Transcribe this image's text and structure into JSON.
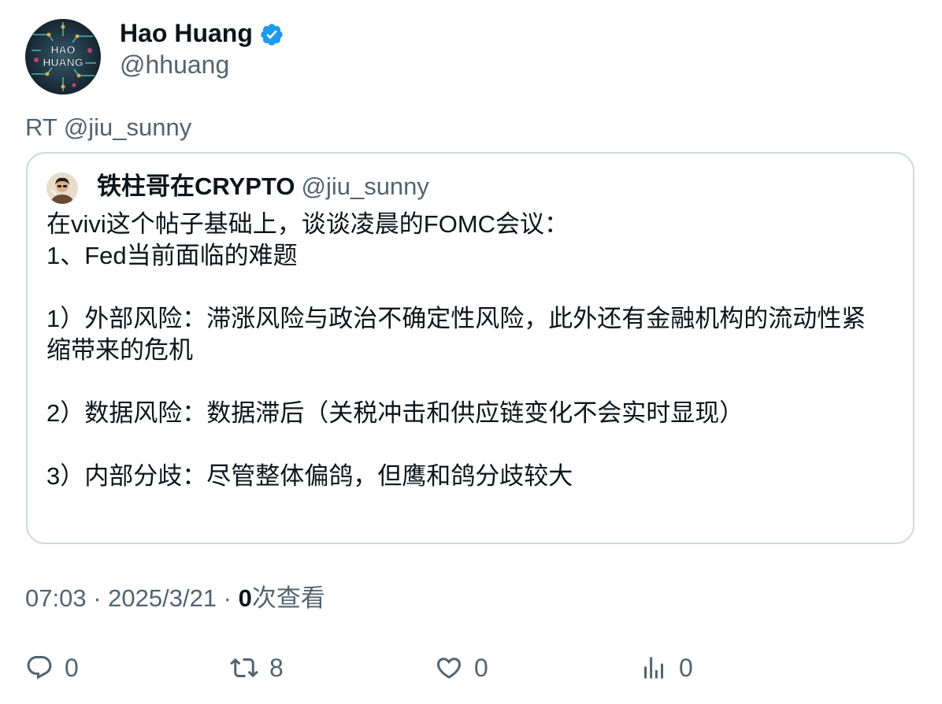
{
  "author": {
    "name": "Hao Huang",
    "handle": "@hhuang",
    "avatar_text_line1": "HAO",
    "avatar_text_line2": "HUANG",
    "verified_color": "#1d9bf0"
  },
  "retweet_line": "RT @jiu_sunny",
  "quote": {
    "author_name": "铁柱哥在CRYPTO",
    "author_handle": "@jiu_sunny",
    "lines": [
      "在vivi这个帖子基础上，谈谈凌晨的FOMC会议：",
      "1、Fed当前面临的难题",
      "",
      "1）外部风险：滞涨风险与政治不确定性风险，此外还有金融机构的流动性紧",
      "缩带来的危机",
      "",
      "2）数据风险：数据滞后（关税冲击和供应链变化不会实时显现）",
      "",
      "3）内部分歧：尽管整体偏鸽，但鹰和鸽分歧较大"
    ]
  },
  "meta": {
    "time": "07:03",
    "separator": " · ",
    "date": "2025/3/21",
    "views_count": "0",
    "views_label": "次查看"
  },
  "actions": {
    "reply_count": "0",
    "retweet_count": "8",
    "like_count": "0",
    "views_count": "0"
  },
  "colors": {
    "text_primary": "#0f1419",
    "text_secondary": "#536471",
    "border": "#cfd9de",
    "accent": "#1d9bf0"
  }
}
